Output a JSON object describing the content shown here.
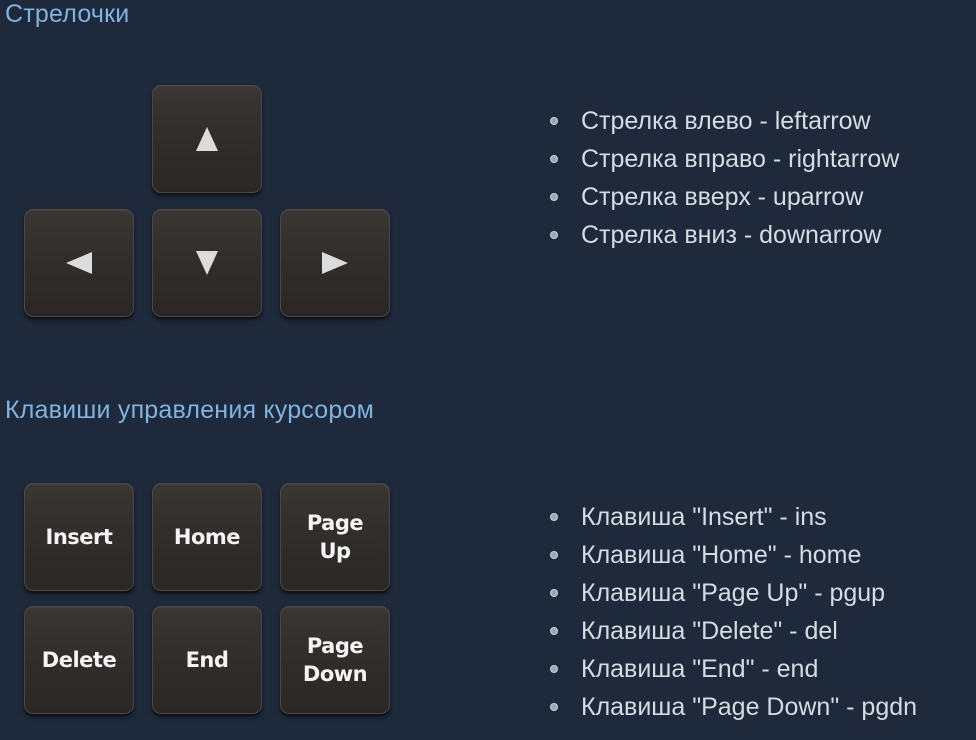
{
  "sections": {
    "arrows": {
      "title": "Стрелочки",
      "keys": {
        "up": {
          "icon": "arrow-up-icon"
        },
        "left": {
          "icon": "arrow-left-icon"
        },
        "down": {
          "icon": "arrow-down-icon"
        },
        "right": {
          "icon": "arrow-right-icon"
        }
      },
      "items": [
        "Стрелка влево - leftarrow",
        "Стрелка вправо - rightarrow",
        "Стрелка вверх - uparrow",
        "Стрелка вниз - downarrow"
      ]
    },
    "cursor": {
      "title": "Клавиши управления курсором",
      "keys": [
        {
          "label": "Insert"
        },
        {
          "label": "Home"
        },
        {
          "label": "Page\nUp"
        },
        {
          "label": "Delete"
        },
        {
          "label": "End"
        },
        {
          "label": "Page\nDown"
        }
      ],
      "items": [
        "Клавиша \"Insert\" - ins",
        "Клавиша \"Home\" - home",
        "Клавиша \"Page Up\" - pgup",
        "Клавиша \"Delete\" - del",
        "Клавиша \"End\" - end",
        "Клавиша \"Page Down\" - pgdn"
      ]
    }
  },
  "colors": {
    "background": "#1e2a3b",
    "title": "#7fb3e0",
    "list_text": "#d6dbe2",
    "key_face": "#332f2d",
    "key_label": "#f4f4f4"
  }
}
